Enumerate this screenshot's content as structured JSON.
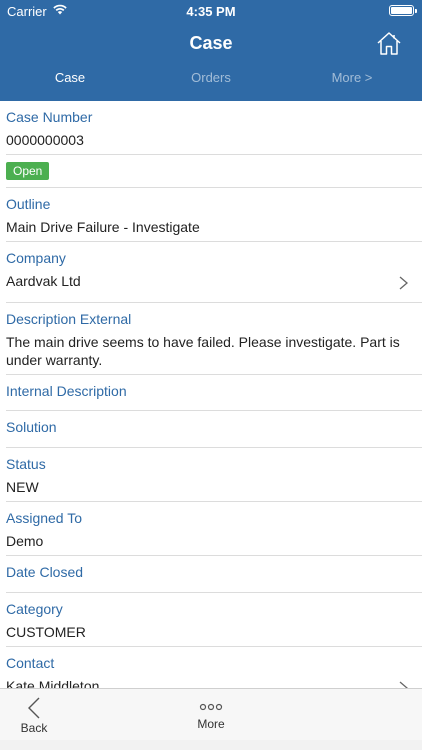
{
  "status_bar": {
    "carrier": "Carrier",
    "time": "4:35 PM"
  },
  "nav": {
    "title": "Case"
  },
  "tabs": [
    {
      "label": "Case"
    },
    {
      "label": "Orders"
    },
    {
      "label": "More >"
    }
  ],
  "fields": {
    "case_number": {
      "label": "Case Number",
      "value": "0000000003"
    },
    "status_badge": "Open",
    "outline": {
      "label": "Outline",
      "value": "Main Drive Failure - Investigate"
    },
    "company": {
      "label": "Company",
      "value": "Aardvak Ltd"
    },
    "description_external": {
      "label": "Description External",
      "value": "The main drive seems to have failed. Please investigate. Part is under warranty."
    },
    "internal_description": {
      "label": "Internal Description"
    },
    "solution": {
      "label": "Solution"
    },
    "status": {
      "label": "Status",
      "value": "NEW"
    },
    "assigned_to": {
      "label": "Assigned To",
      "value": "Demo"
    },
    "date_closed": {
      "label": "Date Closed"
    },
    "category": {
      "label": "Category",
      "value": "CUSTOMER"
    },
    "contact": {
      "label": "Contact",
      "value": "Kate Middleton"
    }
  },
  "bottom_bar": {
    "back": "Back",
    "more": "More"
  },
  "colors": {
    "header": "#2f6aa6",
    "label": "#2f6aa6",
    "badge": "#4caf50"
  }
}
